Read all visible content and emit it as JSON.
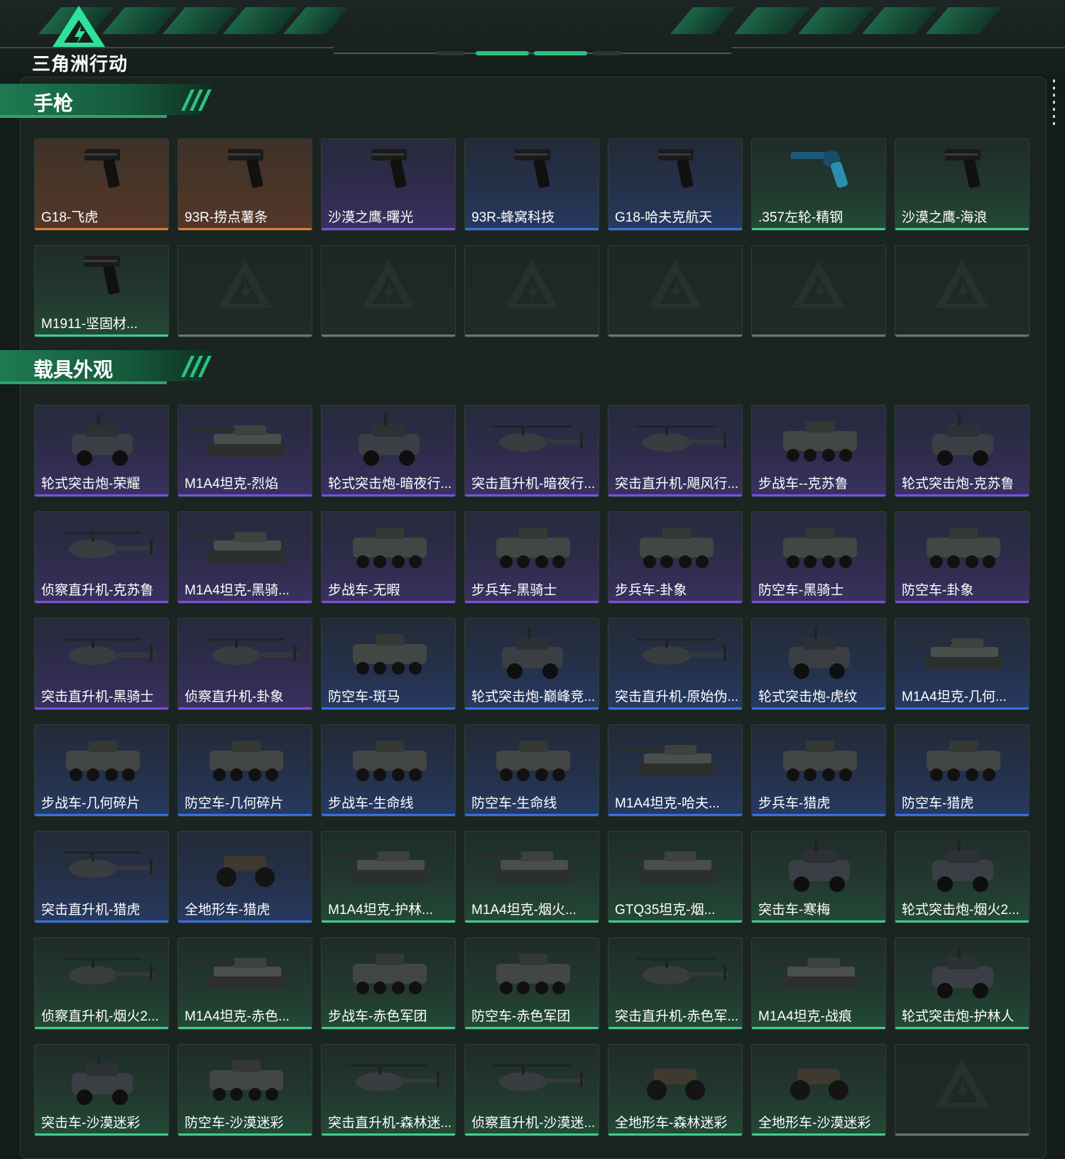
{
  "header": {
    "logo_text": "三角洲行动"
  },
  "sections": [
    {
      "title": "手枪",
      "cards": [
        {
          "label": "G18-飞虎",
          "rarity": "orange",
          "kind": "pistol"
        },
        {
          "label": "93R-捞点薯条",
          "rarity": "orange",
          "kind": "pistol"
        },
        {
          "label": "沙漠之鹰-曙光",
          "rarity": "purple",
          "kind": "pistol"
        },
        {
          "label": "93R-蜂窝科技",
          "rarity": "blue",
          "kind": "pistol"
        },
        {
          "label": "G18-哈夫克航天",
          "rarity": "blue",
          "kind": "pistol"
        },
        {
          "label": ".357左轮-精钢",
          "rarity": "green",
          "kind": "revolver"
        },
        {
          "label": "沙漠之鹰-海浪",
          "rarity": "green",
          "kind": "pistol"
        },
        {
          "label": "M1911-坚固材...",
          "rarity": "green",
          "kind": "pistol"
        },
        {
          "label": "",
          "rarity": "empty",
          "kind": "empty"
        },
        {
          "label": "",
          "rarity": "empty",
          "kind": "empty"
        },
        {
          "label": "",
          "rarity": "empty",
          "kind": "empty"
        },
        {
          "label": "",
          "rarity": "empty",
          "kind": "empty"
        },
        {
          "label": "",
          "rarity": "empty",
          "kind": "empty"
        },
        {
          "label": "",
          "rarity": "empty",
          "kind": "empty"
        }
      ]
    },
    {
      "title": "载具外观",
      "cards": [
        {
          "label": "轮式突击炮-荣耀",
          "rarity": "purple",
          "kind": "car"
        },
        {
          "label": "M1A4坦克-烈焰",
          "rarity": "purple",
          "kind": "tank"
        },
        {
          "label": "轮式突击炮-暗夜行...",
          "rarity": "purple",
          "kind": "car"
        },
        {
          "label": "突击直升机-暗夜行...",
          "rarity": "purple",
          "kind": "heli"
        },
        {
          "label": "突击直升机-飓风行...",
          "rarity": "purple",
          "kind": "heli"
        },
        {
          "label": "步战车--克苏鲁",
          "rarity": "purple",
          "kind": "apc"
        },
        {
          "label": "轮式突击炮-克苏鲁",
          "rarity": "purple",
          "kind": "car"
        },
        {
          "label": "侦察直升机-克苏鲁",
          "rarity": "purple",
          "kind": "heli"
        },
        {
          "label": "M1A4坦克-黑骑...",
          "rarity": "purple",
          "kind": "tank"
        },
        {
          "label": "步战车-无暇",
          "rarity": "purple",
          "kind": "apc"
        },
        {
          "label": "步兵车-黑骑士",
          "rarity": "purple",
          "kind": "apc"
        },
        {
          "label": "步兵车-卦象",
          "rarity": "purple",
          "kind": "apc"
        },
        {
          "label": "防空车-黑骑士",
          "rarity": "purple",
          "kind": "apc"
        },
        {
          "label": "防空车-卦象",
          "rarity": "purple",
          "kind": "apc"
        },
        {
          "label": "突击直升机-黑骑士",
          "rarity": "purple",
          "kind": "heli"
        },
        {
          "label": "侦察直升机-卦象",
          "rarity": "purple",
          "kind": "heli"
        },
        {
          "label": "防空车-斑马",
          "rarity": "blue",
          "kind": "apc"
        },
        {
          "label": "轮式突击炮-巅峰竞...",
          "rarity": "blue",
          "kind": "car"
        },
        {
          "label": "突击直升机-原始伪...",
          "rarity": "blue",
          "kind": "heli"
        },
        {
          "label": "轮式突击炮-虎纹",
          "rarity": "blue",
          "kind": "car"
        },
        {
          "label": "M1A4坦克-几何...",
          "rarity": "blue",
          "kind": "tank"
        },
        {
          "label": "步战车-几何碎片",
          "rarity": "blue",
          "kind": "apc"
        },
        {
          "label": "防空车-几何碎片",
          "rarity": "blue",
          "kind": "apc"
        },
        {
          "label": "步战车-生命线",
          "rarity": "blue",
          "kind": "apc"
        },
        {
          "label": "防空车-生命线",
          "rarity": "blue",
          "kind": "apc"
        },
        {
          "label": "M1A4坦克-哈夫...",
          "rarity": "blue",
          "kind": "tank"
        },
        {
          "label": "步兵车-猎虎",
          "rarity": "blue",
          "kind": "apc"
        },
        {
          "label": "防空车-猎虎",
          "rarity": "blue",
          "kind": "apc"
        },
        {
          "label": "突击直升机-猎虎",
          "rarity": "blue",
          "kind": "heli"
        },
        {
          "label": "全地形车-猎虎",
          "rarity": "blue",
          "kind": "atv"
        },
        {
          "label": "M1A4坦克-护林...",
          "rarity": "green",
          "kind": "tank"
        },
        {
          "label": "M1A4坦克-烟火...",
          "rarity": "green",
          "kind": "tank"
        },
        {
          "label": "GTQ35坦克-烟...",
          "rarity": "green",
          "kind": "tank"
        },
        {
          "label": "突击车-寒梅",
          "rarity": "green",
          "kind": "car"
        },
        {
          "label": "轮式突击炮-烟火2...",
          "rarity": "green",
          "kind": "car"
        },
        {
          "label": "侦察直升机-烟火2...",
          "rarity": "green",
          "kind": "heli"
        },
        {
          "label": "M1A4坦克-赤色...",
          "rarity": "green",
          "kind": "tank"
        },
        {
          "label": "步战车-赤色军团",
          "rarity": "green",
          "kind": "apc"
        },
        {
          "label": "防空车-赤色军团",
          "rarity": "green",
          "kind": "apc"
        },
        {
          "label": "突击直升机-赤色军...",
          "rarity": "green",
          "kind": "heli"
        },
        {
          "label": "M1A4坦克-战痕",
          "rarity": "green",
          "kind": "tank"
        },
        {
          "label": "轮式突击炮-护林人",
          "rarity": "green",
          "kind": "car"
        },
        {
          "label": "突击车-沙漠迷彩",
          "rarity": "green",
          "kind": "car"
        },
        {
          "label": "防空车-沙漠迷彩",
          "rarity": "green",
          "kind": "apc"
        },
        {
          "label": "突击直升机-森林迷...",
          "rarity": "green",
          "kind": "heli"
        },
        {
          "label": "侦察直升机-沙漠迷...",
          "rarity": "green",
          "kind": "heli"
        },
        {
          "label": "全地形车-森林迷彩",
          "rarity": "green",
          "kind": "atv"
        },
        {
          "label": "全地形车-沙漠迷彩",
          "rarity": "green",
          "kind": "atv"
        },
        {
          "label": "",
          "rarity": "empty",
          "kind": "empty"
        }
      ]
    }
  ]
}
